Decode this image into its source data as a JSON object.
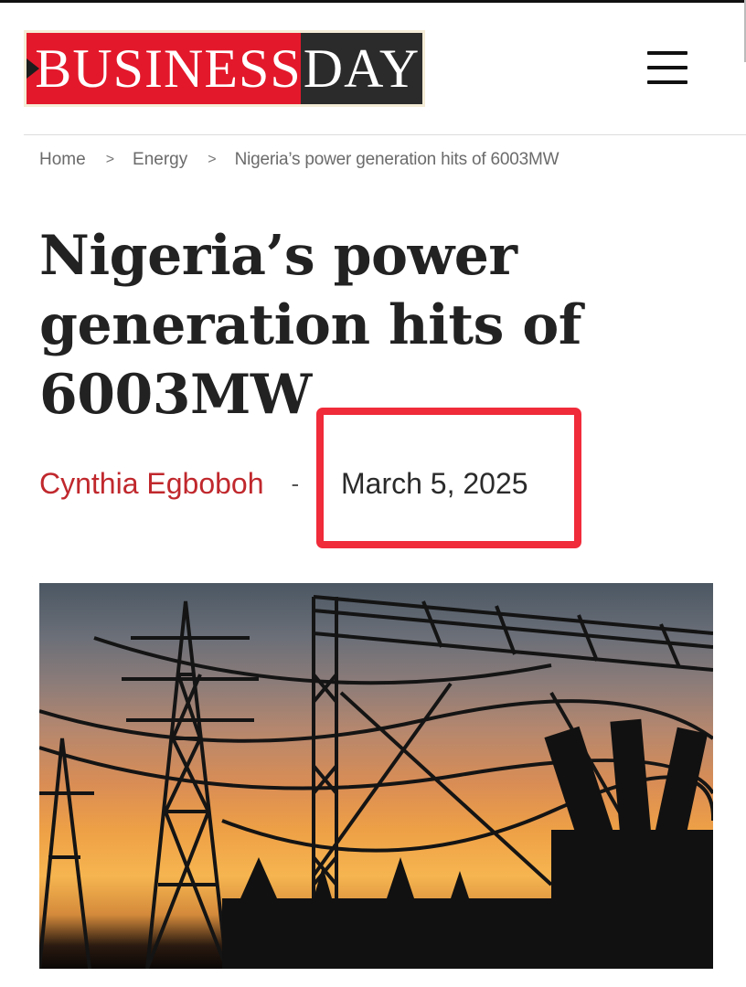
{
  "header": {
    "logo_left": "BUSINESS",
    "logo_right": "DAY",
    "brand_red": "#e3192b",
    "brand_dark": "#2b2b2b",
    "menu_icon": "hamburger-menu-icon"
  },
  "breadcrumb": {
    "home": "Home",
    "separator": ">",
    "section": "Energy",
    "current": "Nigeria’s power generation hits of 6003MW"
  },
  "article": {
    "title": "Nigeria’s power generation hits of 6003MW",
    "author": "Cynthia Egboboh",
    "byline_separator": "-",
    "date": "March 5, 2025",
    "author_color": "#c0282d",
    "highlight_color": "#f02b3a"
  },
  "hero_image": {
    "subject": "electricity-pylons-sunset-image"
  }
}
